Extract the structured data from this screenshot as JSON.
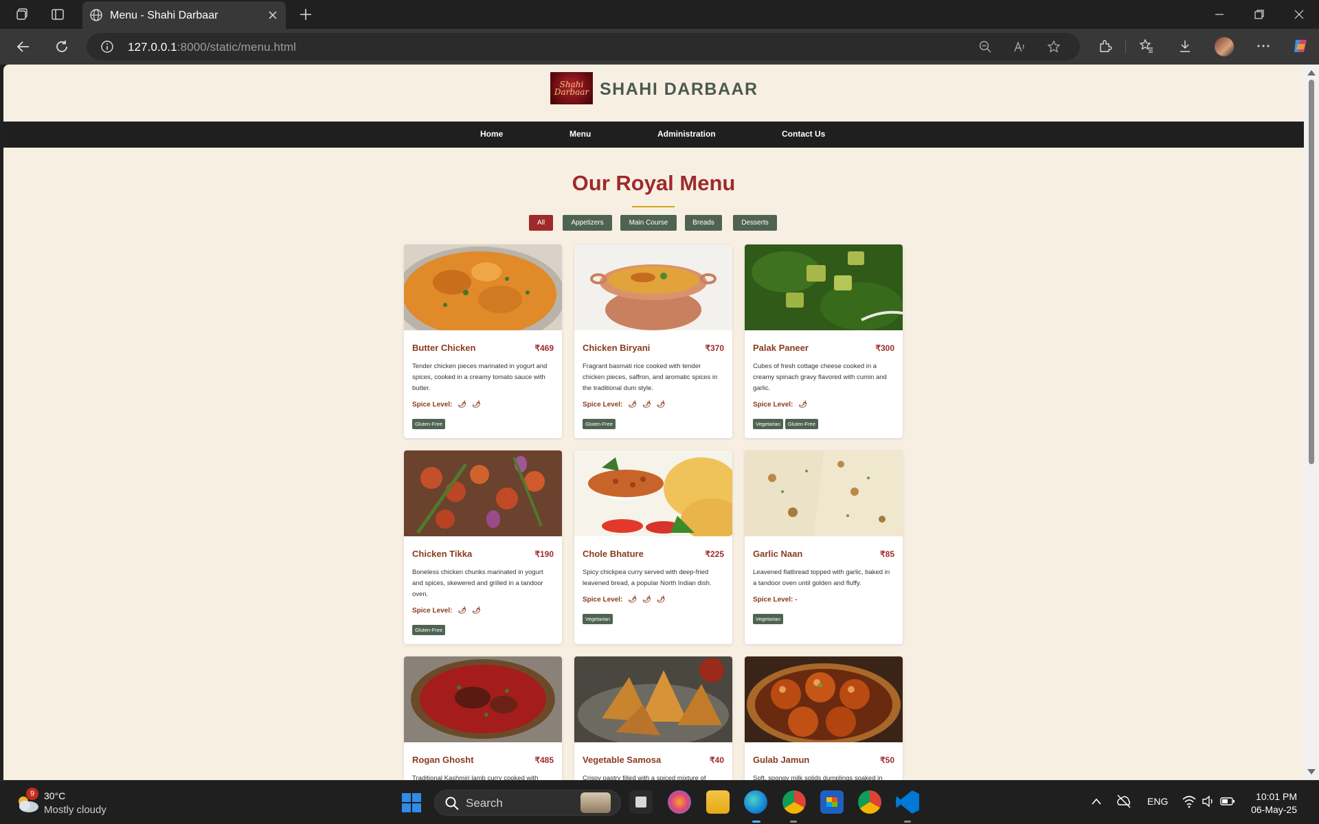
{
  "browser": {
    "tab_title": "Menu - Shahi Darbaar",
    "url_host": "127.0.0.1",
    "url_rest": ":8000/static/menu.html"
  },
  "site": {
    "logo_text": "Shahi Darbaar",
    "brand": "SHAHI DARBAAR",
    "nav": [
      "Home",
      "Menu",
      "Administration",
      "Contact Us"
    ],
    "page_title": "Our Royal Menu",
    "filters": [
      "All",
      "Appetizers",
      "Main Course",
      "Breads",
      "Desserts"
    ],
    "active_filter": "All",
    "spice_label": "Spice Level:",
    "items": [
      {
        "name": "Butter Chicken",
        "price": "₹469",
        "desc": "Tender chicken pieces marinated in yogurt and spices, cooked in a creamy tomato sauce with butter.",
        "spice": 2,
        "tags": [
          "Gluten-Free"
        ]
      },
      {
        "name": "Chicken Biryani",
        "price": "₹370",
        "desc": "Fragrant basmati rice cooked with tender chicken pieces, saffron, and aromatic spices in the traditional dum style.",
        "spice": 3,
        "tags": [
          "Gluten-Free"
        ]
      },
      {
        "name": "Palak Paneer",
        "price": "₹300",
        "desc": "Cubes of fresh cottage cheese cooked in a creamy spinach gravy flavored with cumin and garlic.",
        "spice": 1,
        "tags": [
          "Vegetarian",
          "Gluten-Free"
        ]
      },
      {
        "name": "Chicken Tikka",
        "price": "₹190",
        "desc": "Boneless chicken chunks marinated in yogurt and spices, skewered and grilled in a tandoor oven.",
        "spice": 2,
        "tags": [
          "Gluten-Free"
        ]
      },
      {
        "name": "Chole Bhature",
        "price": "₹225",
        "desc": "Spicy chickpea curry served with deep-fried leavened bread, a popular North Indian dish.",
        "spice": 3,
        "tags": [
          "Vegetarian"
        ]
      },
      {
        "name": "Garlic Naan",
        "price": "₹85",
        "desc": "Leavened flatbread topped with garlic, baked in a tandoor oven until golden and fluffy.",
        "spice": 0,
        "spice_text": "-",
        "tags": [
          "Vegetarian"
        ]
      },
      {
        "name": "Rogan Ghosht",
        "price": "₹485",
        "desc": "Traditional Kashmiri lamb curry cooked with",
        "spice": 0,
        "tags": []
      },
      {
        "name": "Vegetable Samosa",
        "price": "₹40",
        "desc": "Crispy pastry filled with a spiced mixture of",
        "spice": 0,
        "tags": []
      },
      {
        "name": "Gulab Jamun",
        "price": "₹50",
        "desc": "Soft, spongy milk solids dumplings soaked in",
        "spice": 0,
        "tags": []
      }
    ]
  },
  "taskbar": {
    "weather_badge": "9",
    "temperature": "30°C",
    "weather": "Mostly cloudy",
    "search_placeholder": "Search",
    "language": "ENG",
    "time": "10:01 PM",
    "date": "06-May-25"
  },
  "colors": {
    "page_bg": "#f8efe3",
    "accent_red": "#9e2a2b",
    "tag_green": "#4f6352",
    "nav_bg": "#1f1f1f",
    "title_rule": "#d4a520"
  }
}
